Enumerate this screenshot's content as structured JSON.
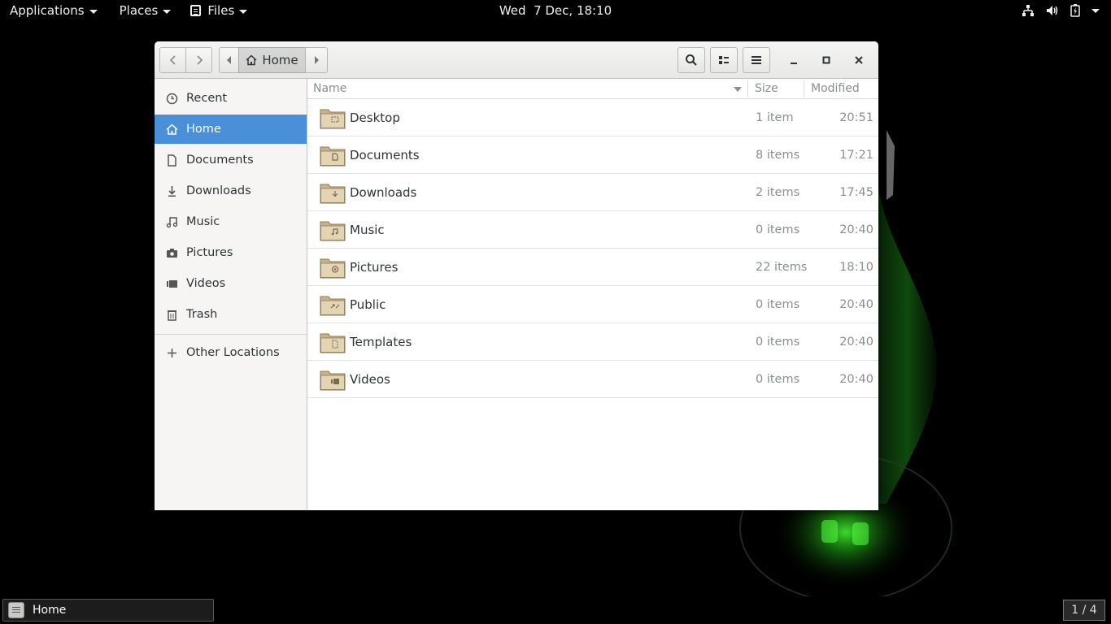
{
  "topbar": {
    "applications_label": "Applications",
    "places_label": "Places",
    "files_label": "Files",
    "clock": "Wed  7 Dec, 18:10"
  },
  "window": {
    "path_home_label": "Home"
  },
  "sidebar": {
    "items": [
      {
        "label": "Recent",
        "icon": "clock-icon",
        "selected": false
      },
      {
        "label": "Home",
        "icon": "home-icon",
        "selected": true
      },
      {
        "label": "Documents",
        "icon": "document-icon",
        "selected": false
      },
      {
        "label": "Downloads",
        "icon": "download-icon",
        "selected": false
      },
      {
        "label": "Music",
        "icon": "music-icon",
        "selected": false
      },
      {
        "label": "Pictures",
        "icon": "camera-icon",
        "selected": false
      },
      {
        "label": "Videos",
        "icon": "video-icon",
        "selected": false
      },
      {
        "label": "Trash",
        "icon": "trash-icon",
        "selected": false
      }
    ],
    "other_locations": "Other Locations"
  },
  "list": {
    "columns": {
      "name": "Name",
      "size": "Size",
      "modified": "Modified"
    },
    "rows": [
      {
        "name": "Desktop",
        "size": "1 item",
        "modified": "20:51",
        "emblem": "desktop"
      },
      {
        "name": "Documents",
        "size": "8 items",
        "modified": "17:21",
        "emblem": "documents"
      },
      {
        "name": "Downloads",
        "size": "2 items",
        "modified": "17:45",
        "emblem": "downloads"
      },
      {
        "name": "Music",
        "size": "0 items",
        "modified": "20:40",
        "emblem": "music"
      },
      {
        "name": "Pictures",
        "size": "22 items",
        "modified": "18:10",
        "emblem": "pictures"
      },
      {
        "name": "Public",
        "size": "0 items",
        "modified": "20:40",
        "emblem": "public"
      },
      {
        "name": "Templates",
        "size": "0 items",
        "modified": "20:40",
        "emblem": "templates"
      },
      {
        "name": "Videos",
        "size": "0 items",
        "modified": "20:40",
        "emblem": "videos"
      }
    ]
  },
  "taskbar": {
    "task_label": "Home",
    "workspace": "1 / 4"
  },
  "colors": {
    "selection": "#4a90d9",
    "folder": "#c8b28a"
  }
}
